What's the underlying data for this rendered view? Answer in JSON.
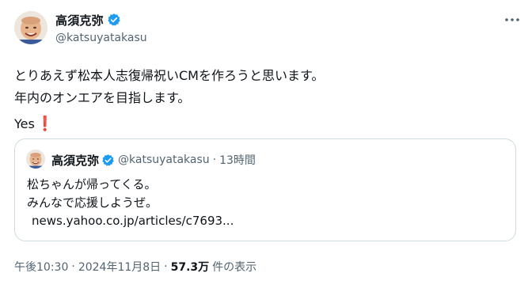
{
  "author": {
    "display_name": "高須克弥",
    "handle": "@katsuyatakasu"
  },
  "colors": {
    "verified": "#1d9bf0",
    "secondary_text": "#536471",
    "exclamation": "#dd2e44",
    "border": "#cfd9de"
  },
  "icons": {
    "verified": "verified-badge-icon",
    "more": "more-options-icon",
    "exclamation": "red-exclamation-emoji"
  },
  "tweet": {
    "lines": [
      "とりあえず松本人志復帰祝いCMを作ろうと思います。",
      "年内のオンエアを目指します。",
      "Yes"
    ],
    "emoji": "❗"
  },
  "quote": {
    "display_name": "高須克弥",
    "handle": "@katsuyatakasu",
    "separator": "·",
    "time": "13時間",
    "lines": [
      "松ちゃんが帰ってくる。",
      "みんなで応援しようぜ。"
    ],
    "link": "news.yahoo.co.jp/articles/c7693..."
  },
  "meta": {
    "time": "午後10:30",
    "separator": "·",
    "date": "2024年11月8日",
    "views_count": "57.3万",
    "views_label": "件の表示"
  }
}
